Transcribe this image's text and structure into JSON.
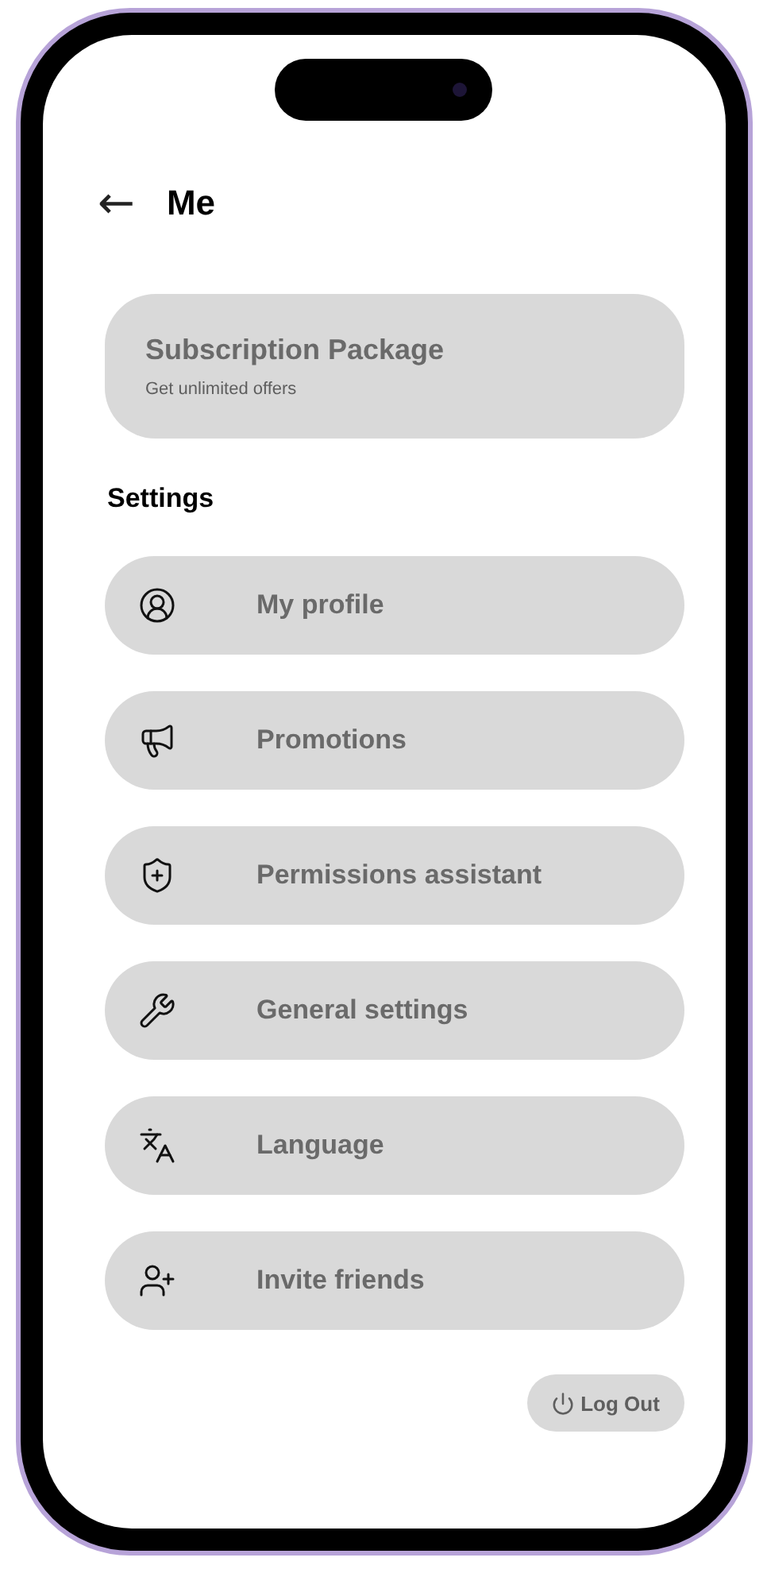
{
  "header": {
    "back": "←",
    "title": "Me"
  },
  "subscription": {
    "title": "Subscription Package",
    "subtitle": "Get unlimited offers"
  },
  "settings": {
    "heading": "Settings",
    "items": [
      {
        "label": "My profile"
      },
      {
        "label": "Promotions"
      },
      {
        "label": "Permissions assistant"
      },
      {
        "label": "General settings"
      },
      {
        "label": "Language"
      },
      {
        "label": "Invite friends"
      }
    ]
  },
  "logout": {
    "label": "Log Out"
  }
}
